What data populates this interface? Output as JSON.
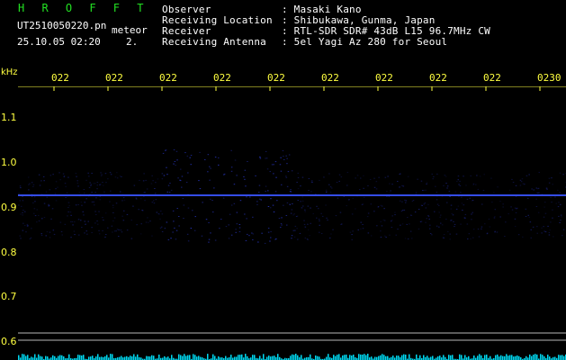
{
  "header": {
    "brand": "H R O F F T",
    "filename": "UT2510050220.pn",
    "mode_label": "meteor",
    "datetime": "25.10.05 02:20",
    "page_indicator": "2.",
    "info_rows": [
      {
        "key": "Observer",
        "value": ": Masaki Kano"
      },
      {
        "key": "Receiving Location",
        "value": ": Shibukawa, Gunma, Japan"
      },
      {
        "key": "Receiver",
        "value": ": RTL-SDR SDR# 43dB L15 96.7MHz CW"
      },
      {
        "key": "Receiving Antenna",
        "value": ": 5el Yagi Az 280 for Seoul"
      }
    ]
  },
  "axis": {
    "unit": "kHz",
    "time_ticks": [
      "022",
      "022",
      "022",
      "022",
      "022",
      "022",
      "022",
      "022",
      "022",
      "0230"
    ],
    "freq_ticks": [
      "1.1",
      "1.0",
      "0.9",
      "0.8",
      "0.7",
      "0.6"
    ]
  },
  "colors": {
    "background": "#000000",
    "text": "#ffffff",
    "brand": "#22e022",
    "axis_label": "#ffff40",
    "signal": "#3a55ff",
    "spectrum": "#00d8f0"
  }
}
